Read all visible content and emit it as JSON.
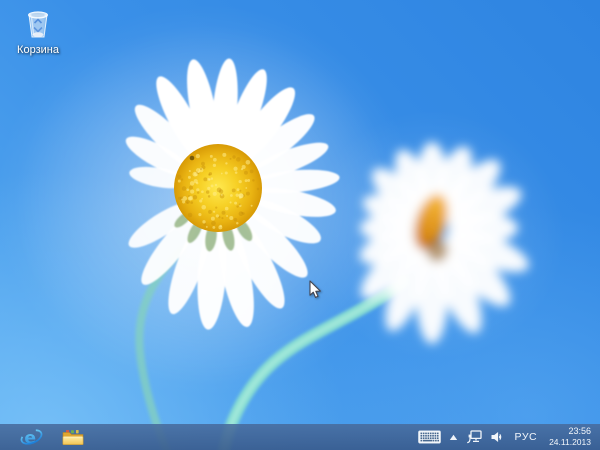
{
  "desktop": {
    "icons": [
      {
        "name": "recycle-bin",
        "label": "Корзина"
      }
    ]
  },
  "taskbar": {
    "pinned": [
      {
        "icon": "internet-explorer-icon"
      },
      {
        "icon": "file-explorer-icon"
      }
    ],
    "tray": {
      "icons": [
        "touch-keyboard-icon",
        "show-hidden-icons-icon",
        "network-icon",
        "volume-icon"
      ],
      "language": "РУС",
      "clock": {
        "time": "23:56",
        "date": "24.11.2013"
      }
    }
  },
  "colors": {
    "sky_top": "#2e84e1",
    "sky_bottom": "#58abf1",
    "taskbar": "#46699b",
    "daisy_disc": "#f6cf24",
    "daisy_disc_edge": "#d79a06",
    "stem": "#8ce2cf",
    "blurred_flower_center": "#e8941c"
  }
}
